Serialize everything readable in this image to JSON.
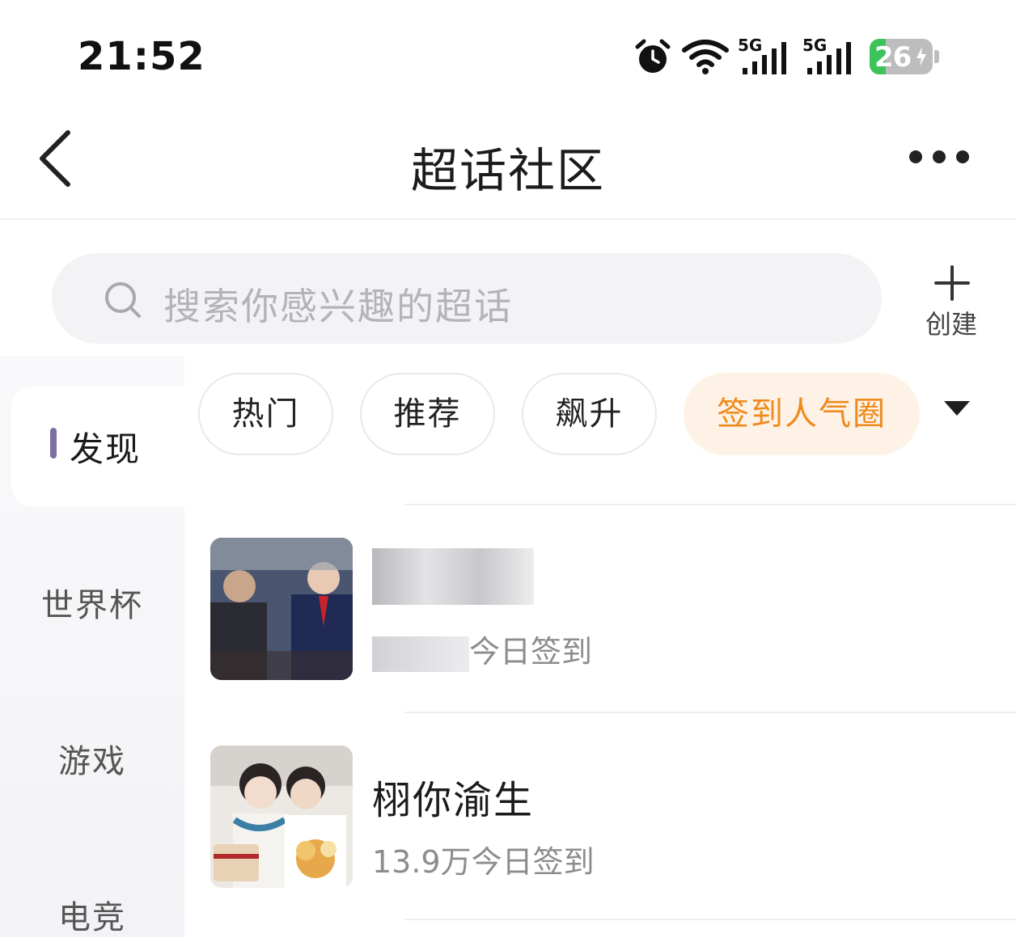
{
  "status_bar": {
    "time": "21:52",
    "signal_1": "5G",
    "signal_2": "5G",
    "battery_level": "26",
    "battery_fraction": 0.26,
    "icons": [
      "alarm-icon",
      "wifi-icon",
      "signal-5g-icon",
      "signal-5g-icon",
      "battery-charging-icon"
    ]
  },
  "header": {
    "title": "超话社区",
    "back_icon": "chevron-left-icon",
    "more_icon": "more-horizontal-icon"
  },
  "search": {
    "placeholder": "搜索你感兴趣的超话",
    "icon": "search-icon"
  },
  "create": {
    "label": "创建",
    "icon": "plus-icon"
  },
  "categories": [
    {
      "label": "发现",
      "active": true
    },
    {
      "label": "世界杯",
      "active": false
    },
    {
      "label": "游戏",
      "active": false
    },
    {
      "label": "电竞",
      "active": false
    }
  ],
  "tabs": [
    {
      "label": "热门",
      "active": false
    },
    {
      "label": "推荐",
      "active": false
    },
    {
      "label": "飙升",
      "active": false
    },
    {
      "label": "签到人气圈",
      "active": true
    }
  ],
  "tabs_expand_icon": "caret-down-icon",
  "topics": [
    {
      "name": "",
      "checkins": "今日签到",
      "redacted": true
    },
    {
      "name": "栩你渝生",
      "checkins": "13.9万今日签到",
      "redacted": false
    }
  ],
  "colors": {
    "accent_orange": "#f08a1c",
    "active_bar": "#7e6fa0",
    "battery_green": "#3cc35b"
  }
}
